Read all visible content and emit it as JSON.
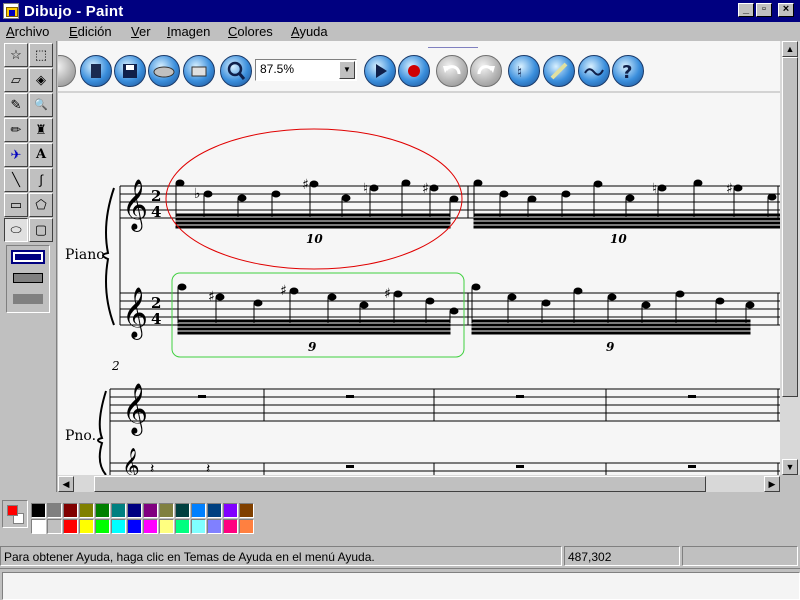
{
  "window": {
    "title": "Dibujo - Paint",
    "controls": {
      "minimize": "_",
      "maximize": "▫",
      "close": "×"
    }
  },
  "menu": [
    {
      "label": "Archivo",
      "ul": "A",
      "rest": "rchivo"
    },
    {
      "label": "Edición",
      "ul": "E",
      "rest": "dición"
    },
    {
      "label": "Ver",
      "ul": "V",
      "rest": "er"
    },
    {
      "label": "Imagen",
      "ul": "I",
      "rest": "magen"
    },
    {
      "label": "Colores",
      "ul": "C",
      "rest": "olores"
    },
    {
      "label": "Ayuda",
      "ul": "A",
      "rest": "yuda"
    }
  ],
  "tools": [
    {
      "name": "free-select-tool",
      "glyph": "☆"
    },
    {
      "name": "rect-select-tool",
      "glyph": "⬚"
    },
    {
      "name": "eraser-tool",
      "glyph": "▱"
    },
    {
      "name": "fill-tool",
      "glyph": "◈"
    },
    {
      "name": "color-picker-tool",
      "glyph": "✎"
    },
    {
      "name": "magnifier-tool",
      "glyph": "🔍"
    },
    {
      "name": "pencil-tool",
      "glyph": "✏"
    },
    {
      "name": "brush-tool",
      "glyph": "♜"
    },
    {
      "name": "airbrush-tool",
      "glyph": "✈"
    },
    {
      "name": "text-tool",
      "glyph": "A"
    },
    {
      "name": "line-tool",
      "glyph": "╲"
    },
    {
      "name": "curve-tool",
      "glyph": "∫"
    },
    {
      "name": "rectangle-tool",
      "glyph": "▭"
    },
    {
      "name": "polygon-tool",
      "glyph": "⬠"
    },
    {
      "name": "ellipse-tool",
      "glyph": "⬭"
    },
    {
      "name": "rounded-rect-tool",
      "glyph": "▢"
    }
  ],
  "score_toolbar": {
    "zoom": "87.5%"
  },
  "score": {
    "instrument_top": "Piano",
    "instrument_bottom": "Pno.",
    "measure_number": "2",
    "tuplets": [
      "10",
      "10",
      "9",
      "9"
    ]
  },
  "palette": {
    "foreground": "#ff0000",
    "background": "#ffffff",
    "colors_top": [
      "#000000",
      "#808080",
      "#800000",
      "#808000",
      "#008000",
      "#008080",
      "#000080",
      "#800080",
      "#808040",
      "#004040",
      "#0080ff",
      "#004080",
      "#8000ff",
      "#804000"
    ],
    "colors_bottom": [
      "#ffffff",
      "#c0c0c0",
      "#ff0000",
      "#ffff00",
      "#00ff00",
      "#00ffff",
      "#0000ff",
      "#ff00ff",
      "#ffff80",
      "#00ff80",
      "#80ffff",
      "#8080ff",
      "#ff0080",
      "#ff8040"
    ]
  },
  "status": {
    "help_text": "Para obtener Ayuda, haga clic en Temas de Ayuda en el menú Ayuda.",
    "coords": "487,302",
    "size": ""
  }
}
